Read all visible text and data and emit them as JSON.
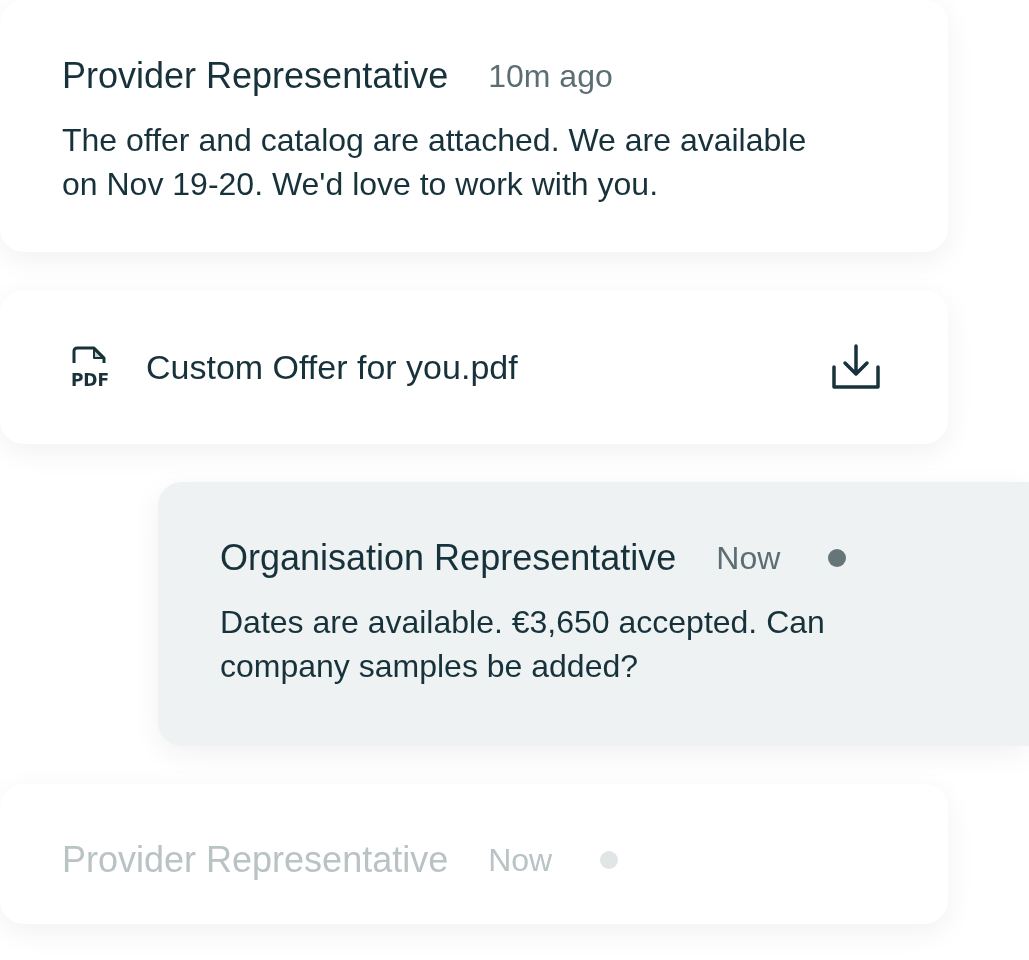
{
  "messages": [
    {
      "kind": "incoming",
      "sender": "Provider Representative",
      "time": "10m ago",
      "unread": false,
      "faded": false,
      "body": "The offer and catalog are attached. We are available on Nov 19-20. We'd love to work with you."
    },
    {
      "kind": "attachment",
      "file_type": "PDF",
      "file_name": "Custom Offer for you.pdf"
    },
    {
      "kind": "outgoing",
      "sender": "Organisation Representative",
      "time": "Now",
      "unread": true,
      "faded": false,
      "body": "Dates are available. €3,650 accepted. Can company samples be added?"
    },
    {
      "kind": "incoming",
      "sender": "Provider Representative",
      "time": "Now",
      "unread": true,
      "faded": true
    }
  ]
}
